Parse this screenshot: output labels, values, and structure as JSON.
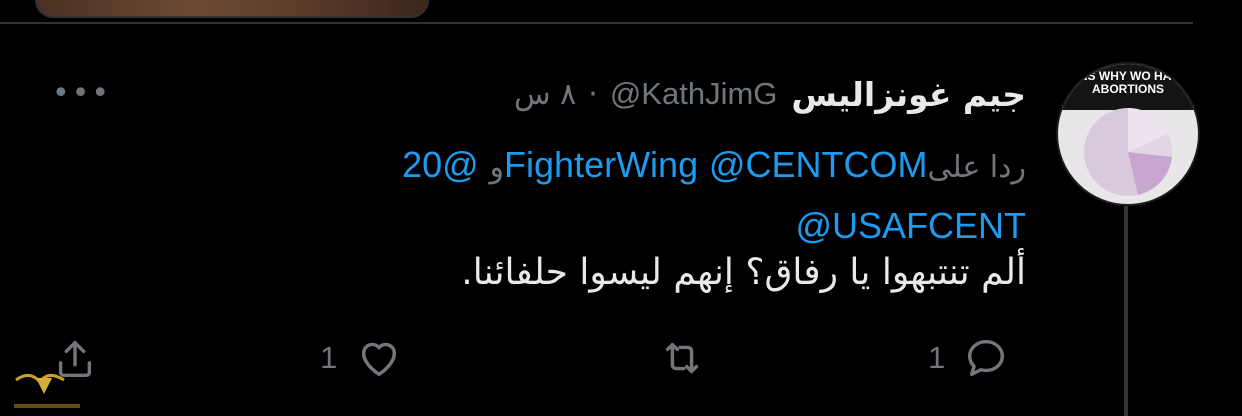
{
  "tweet": {
    "display_name": "جيم غونزاليس",
    "handle": "@KathJimG",
    "separator": "·",
    "time": "٨ س",
    "more_label": "•••",
    "reply_label": "ردا على",
    "reply_mentions": [
      "@CENTCOM",
      "@20FighterWing",
      "@USAFCENT"
    ],
    "reply_conjunction": "و",
    "body": "ألم تنتبهوا يا رفاق؟ إنهم ليسوا حلفائنا.",
    "avatar_text": "ONS WHY WO HAVE ABORTIONS"
  },
  "actions": {
    "reply_count": "1",
    "retweet_count": "",
    "like_count": "1"
  },
  "icons": {
    "reply": "reply-icon",
    "retweet": "retweet-icon",
    "like": "heart-icon",
    "share": "share-icon",
    "more": "more-icon"
  },
  "colors": {
    "background": "#000000",
    "text": "#e7e9ea",
    "muted": "#71767b",
    "link": "#1d9bf0",
    "divider": "#2f3336"
  }
}
